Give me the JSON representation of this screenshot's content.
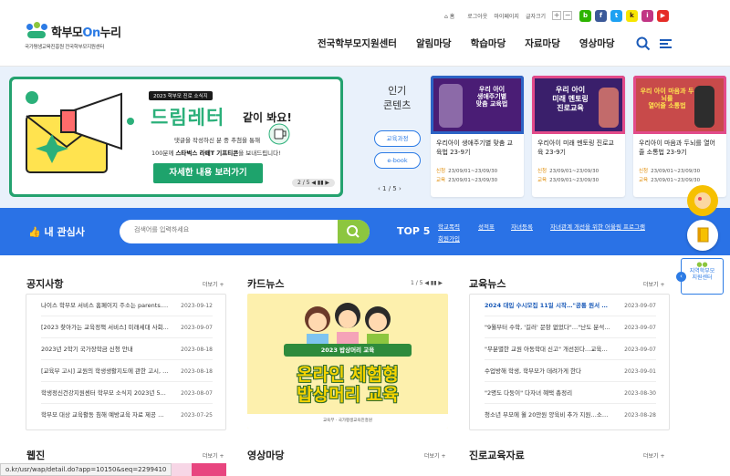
{
  "header": {
    "logo_title_pre": "학부모",
    "logo_title_on": "On",
    "logo_title_post": "누리",
    "logo_sub": "국가평생교육진흥원 전국학부모지원센터",
    "util": [
      "홈",
      "로그아웃",
      "마이페이지",
      "글자크기"
    ],
    "font_plus": "+",
    "font_minus": "−",
    "sns": [
      {
        "name": "blog-icon",
        "label": "b",
        "color": "#2db400"
      },
      {
        "name": "facebook-icon",
        "label": "f",
        "color": "#3b5998"
      },
      {
        "name": "twitter-icon",
        "label": "t",
        "color": "#1da1f2"
      },
      {
        "name": "kakao-icon",
        "label": "k",
        "color": "#f7e600"
      },
      {
        "name": "instagram-icon",
        "label": "i",
        "color": "#c13584"
      },
      {
        "name": "youtube-icon",
        "label": "▶",
        "color": "#e52d27"
      }
    ],
    "gnb": [
      "전국학부모지원센터",
      "알림마당",
      "학습마당",
      "자료마당",
      "영상마당"
    ]
  },
  "banner": {
    "badge": "2023 학부모 진로 소식지",
    "headline": "드림레터",
    "headline_tail": "같이 봐요!",
    "line1": "댓글을 작성하신 분 중 추첨을 통해",
    "line2_pre": "100분께",
    "line2_bold": "스타벅스 라떼T 기프티콘",
    "line2_post": "을 보내드립니다!",
    "button": "자세한 내용 보러가기",
    "pager": "2 / 5  ◀ ▮▮ ▶"
  },
  "popular": {
    "title_line1": "인기",
    "title_line2": "콘텐츠",
    "buttons": [
      "교육과정",
      "e-book"
    ],
    "pager": "‹   1 / 5   ›",
    "cards": [
      {
        "thumb": "우리 아이\n생애주기별\n맞춤 교육법",
        "title": "우리아이 생애주기별 맞춤 교육법 23-9기",
        "apply_label": "신청",
        "apply": "23/09/01~23/09/30",
        "edu_label": "교육",
        "edu": "23/09/01~23/09/30"
      },
      {
        "thumb": "우리 아이\n미래 멘토링\n진로교육",
        "title": "우리아이 미래 멘토링 진로교육 23-9기",
        "apply_label": "신청",
        "apply": "23/09/01~23/09/30",
        "edu_label": "교육",
        "edu": "23/09/01~23/09/30"
      },
      {
        "thumb": "우리 아이 마음과 두뇌를\n열어줄 소통법",
        "title": "우리아이 마음과 두뇌를 열어줄 소통법 23-9기",
        "apply_label": "신청",
        "apply": "23/09/01~23/09/30",
        "edu_label": "교육",
        "edu": "23/09/01~23/09/30"
      }
    ]
  },
  "interest": {
    "title": "내 관심사",
    "placeholder": "검색어를 입력하세요",
    "top5_label": "TOP 5",
    "keywords_row1": [
      "학교폭력",
      "성적표",
      "자녀등록",
      "자녀관계 개선을 위한 어울림 프로그램"
    ],
    "keywords_row2": [
      "회원가입"
    ]
  },
  "float": {
    "center_line1": "지역학부모",
    "center_line2": "지원센터"
  },
  "notice": {
    "title": "공지사항",
    "more": "더보기 +",
    "rows": [
      {
        "t": "나이스 학부모 서비스 홈페이지 주소는 parents.n...",
        "d": "2023-09-12"
      },
      {
        "t": "[2023 찾아가는 교육정책 서비스] 미래세대 사회...",
        "d": "2023-09-07"
      },
      {
        "t": "2023년 2학기 국가장학금 신청 안내",
        "d": "2023-08-18"
      },
      {
        "t": "[교육부 고시] 교원의 학생생활지도에 관한 고시, ...",
        "d": "2023-08-18"
      },
      {
        "t": "학생정신건강지원센터 학부모 소식지 2023년 5...",
        "d": "2023-08-07"
      },
      {
        "t": "학부모 대상 교육활동 침해 예방교육 자료 제공 알림",
        "d": "2023-07-25"
      }
    ]
  },
  "cardnews": {
    "title": "카드뉴스",
    "pager": "1 / 5  ◀ ▮▮ ▶",
    "ribbon": "2023 밥상머리 교육",
    "big_line1": "온라인 체험형",
    "big_line2": "밥상머리 교육",
    "logos": "교육부 · 국가평생교육진흥원"
  },
  "edunews": {
    "title": "교육뉴스",
    "more": "더보기 +",
    "rows": [
      {
        "t": "2024 대입 수시모집 11일 시작…\"공통 원서 미리...",
        "d": "2023-09-07",
        "hl": true
      },
      {
        "t": "\"9월부터 수학, '길러' 문항 없었다\"…\"난도 분석은...",
        "d": "2023-09-07"
      },
      {
        "t": "\"무분별한 교원 아동학대 신고\" 개선된다…교육부...",
        "d": "2023-09-07"
      },
      {
        "t": "수업방해 학생, 학부모가 데려가게 한다",
        "d": "2023-09-01"
      },
      {
        "t": "\"2명도 다둥이\" 다자녀 혜택 총정리",
        "d": "2023-08-30"
      },
      {
        "t": "청소년 부모에 월 20만원 양육비 추가 지원…소득...",
        "d": "2023-08-28"
      }
    ]
  },
  "bottom": {
    "webzine": "웹진",
    "video": "영상마당",
    "career": "진로교육자료",
    "more": "더보기 +"
  },
  "statusbar": "o.kr/usr/wap/detail.do?app=10150&seq=2299410"
}
